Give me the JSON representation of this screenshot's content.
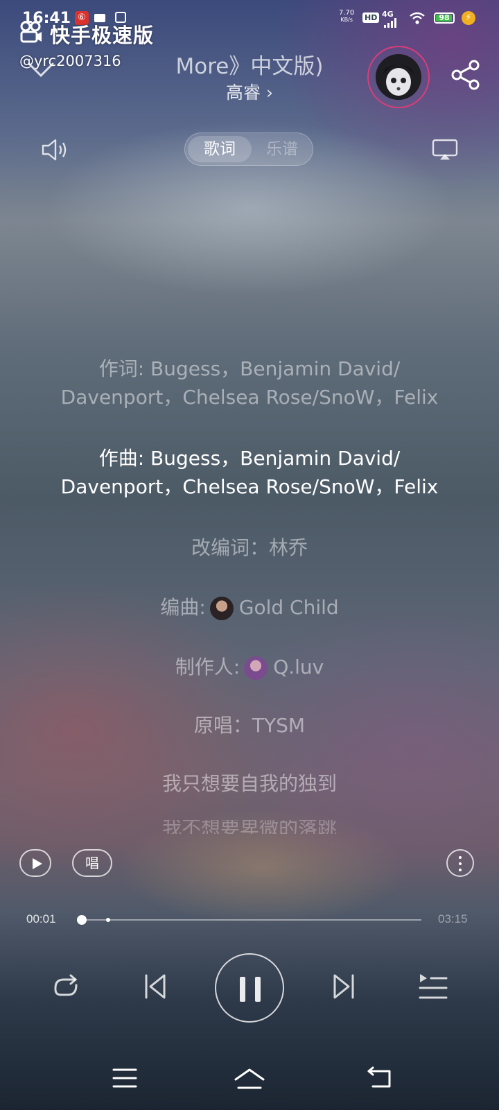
{
  "status_bar": {
    "time": "16:41",
    "net_speed_value": "7.70",
    "net_speed_unit": "KB/s",
    "hd_label": "HD",
    "network_type": "4G",
    "battery": "98",
    "battery_level": 0.98,
    "app_badge": "⑥"
  },
  "watermark": {
    "app_name": "快手极速版",
    "username": "@yrc2007316"
  },
  "header": {
    "song_title": "More》中文版)",
    "artist": "高睿 ›"
  },
  "mode_switch": {
    "active_label": "歌词",
    "inactive_label": "乐谱"
  },
  "lyrics": {
    "lyricist_line1": "作词: Bugess，Benjamin David/",
    "lyricist_line2": "Davenport，Chelsea Rose/SnoW，Felix",
    "composer_line1": "作曲: Bugess，Benjamin David/",
    "composer_line2": "Davenport，Chelsea Rose/SnoW，Felix",
    "adapted_lyrics": "改编词：林乔",
    "arranger_label": "编曲:",
    "arranger_name": "Gold Child",
    "producer_label": "制作人:",
    "producer_name": "Q.luv",
    "original_singer": "原唱：TYSM",
    "line_1": "我只想要自我的独到",
    "line_2": "我不想要卑微的落跳"
  },
  "controls": {
    "sing_label": "唱"
  },
  "progress": {
    "current_time": "00:01",
    "total_time": "03:15",
    "played_fraction": 0.005
  },
  "colors": {
    "battery_green": "#3cc04a",
    "avatar_ring": "#e63c78",
    "charging": "#f0b020"
  }
}
